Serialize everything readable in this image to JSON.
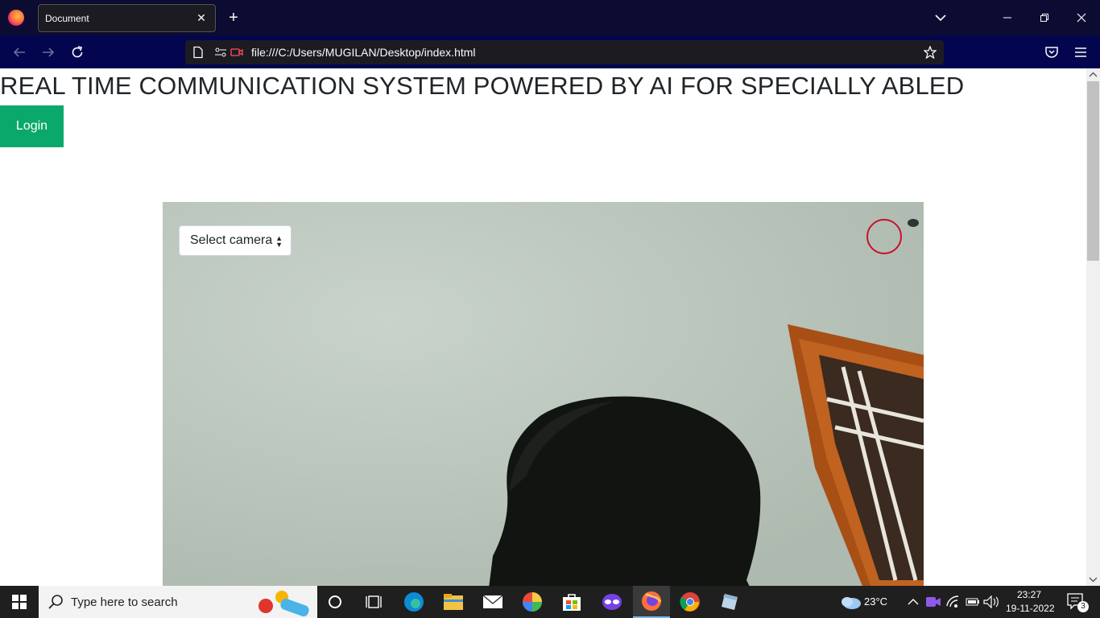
{
  "browser": {
    "tab_title": "Document",
    "url": "file:///C:/Users/MUGILAN/Desktop/index.html"
  },
  "page": {
    "title": "REAL TIME COMMUNICATION SYSTEM POWERED BY AI FOR SPECIALLY ABLED",
    "login_label": "Login",
    "camera_select": "Select camera"
  },
  "taskbar": {
    "search_placeholder": "Type here to search",
    "weather": "23°C",
    "time": "23:27",
    "date": "19-11-2022",
    "notification_count": "3"
  },
  "colors": {
    "titlebar": "#0c0c33",
    "navbar": "#03064e",
    "login_button": "#0aa86a",
    "record_circle": "#c8102e"
  }
}
